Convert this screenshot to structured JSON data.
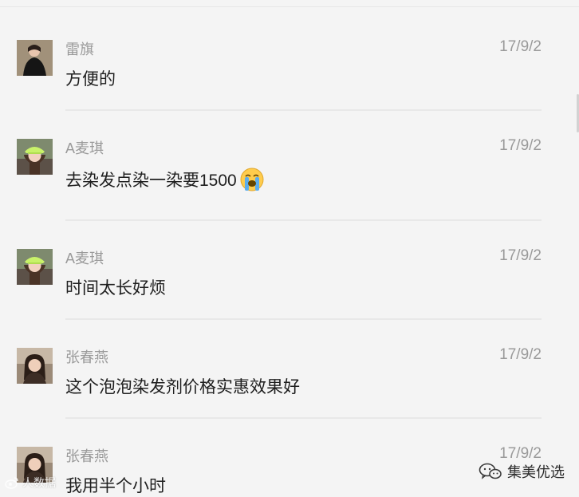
{
  "comments": [
    {
      "name": "雷旗",
      "date": "17/9/2",
      "text": "方便的",
      "emoji": ""
    },
    {
      "name": "A麦琪",
      "date": "17/9/2",
      "text": "去染发点染一染要1500",
      "emoji": "loudly-crying-face-icon"
    },
    {
      "name": "A麦琪",
      "date": "17/9/2",
      "text": "时间太长好烦",
      "emoji": ""
    },
    {
      "name": "张春燕",
      "date": "17/9/2",
      "text": "这个泡泡染发剂价格实惠效果好",
      "emoji": ""
    },
    {
      "name": "张春燕",
      "date": "17/9/2",
      "text": "我用半个小时",
      "emoji": ""
    }
  ],
  "watermarks": {
    "left": "人数据",
    "brand": "集美优选"
  }
}
